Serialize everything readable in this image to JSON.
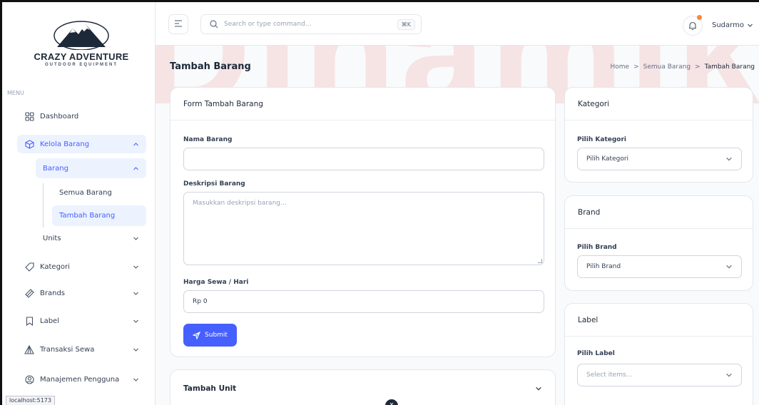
{
  "app": {
    "logo_name": "CRAZY ADVENTURE",
    "logo_sub": "OUTDOOR EQUIPMENT",
    "watermark": "Dinamika"
  },
  "sidebar": {
    "menu_title": "MENU",
    "items": [
      {
        "label": "Dashboard",
        "icon": "grid-icon"
      },
      {
        "label": "Kelola Barang",
        "icon": "box-icon"
      },
      {
        "label": "Barang"
      },
      {
        "label": "Semua Barang"
      },
      {
        "label": "Tambah Barang"
      },
      {
        "label": "Units"
      },
      {
        "label": "Kategori",
        "icon": "tag-icon"
      },
      {
        "label": "Brands",
        "icon": "brand-icon"
      },
      {
        "label": "Label",
        "icon": "bookmark-icon"
      },
      {
        "label": "Transaksi Sewa",
        "icon": "tent-icon"
      },
      {
        "label": "Manajemen Pengguna",
        "icon": "user-circle-icon"
      }
    ]
  },
  "topbar": {
    "search_placeholder": "Search or type command...",
    "shortcut": "⌘K",
    "user_name": "Sudarmo"
  },
  "page": {
    "title": "Tambah Barang",
    "breadcrumb": [
      "Home",
      "Semua Barang",
      "Tambah Barang"
    ]
  },
  "form": {
    "card_title": "Form Tambah Barang",
    "nama_label": "Nama Barang",
    "nama_value": "",
    "deskripsi_label": "Deskripsi Barang",
    "deskripsi_placeholder": "Masukkan deskripsi barang...",
    "harga_label": "Harga Sewa / Hari",
    "harga_value": "Rp 0",
    "submit_label": "Submit"
  },
  "unit_card": {
    "title": "Tambah Unit"
  },
  "kategori_card": {
    "title": "Kategori",
    "label": "Pilih Kategori",
    "selected": "Pilih Kategori"
  },
  "brand_card": {
    "title": "Brand",
    "label": "Pilih Brand",
    "selected": "Pilih Brand"
  },
  "label_card": {
    "title": "Label",
    "label": "Pilih Label",
    "placeholder": "Select items..."
  },
  "statusbar": {
    "url": "localhost:5173"
  },
  "colors": {
    "accent": "#465fff",
    "accent_bg": "#ecf3ff",
    "watermark": "#e0211e",
    "notification": "#fd853a"
  }
}
